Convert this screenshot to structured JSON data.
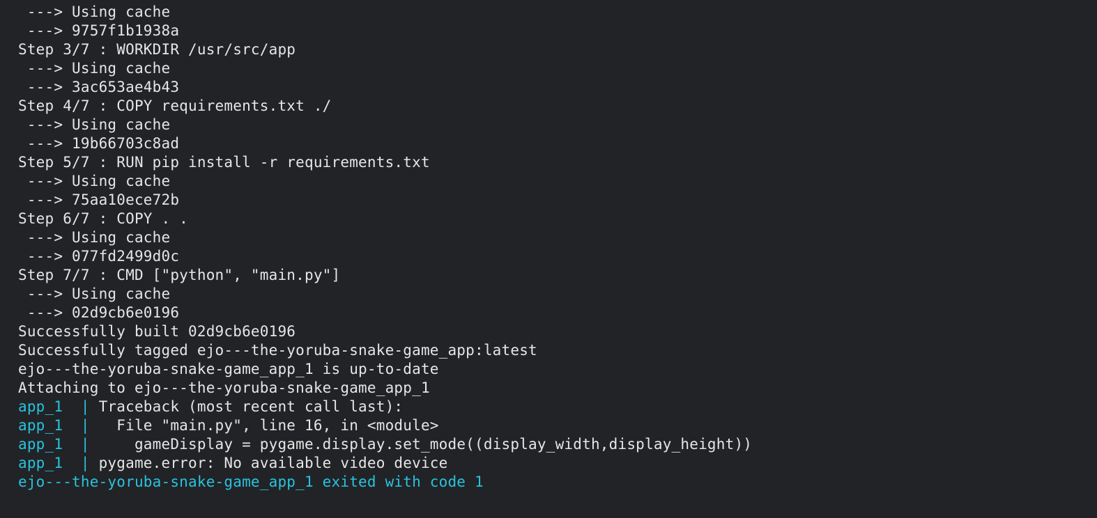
{
  "lines": [
    {
      "segments": [
        {
          "text": " ---> Using cache"
        }
      ]
    },
    {
      "segments": [
        {
          "text": " ---> 9757f1b1938a"
        }
      ]
    },
    {
      "segments": [
        {
          "text": "Step 3/7 : WORKDIR /usr/src/app"
        }
      ]
    },
    {
      "segments": [
        {
          "text": " ---> Using cache"
        }
      ]
    },
    {
      "segments": [
        {
          "text": " ---> 3ac653ae4b43"
        }
      ]
    },
    {
      "segments": [
        {
          "text": "Step 4/7 : COPY requirements.txt ./"
        }
      ]
    },
    {
      "segments": [
        {
          "text": " ---> Using cache"
        }
      ]
    },
    {
      "segments": [
        {
          "text": " ---> 19b66703c8ad"
        }
      ]
    },
    {
      "segments": [
        {
          "text": "Step 5/7 : RUN pip install -r requirements.txt"
        }
      ]
    },
    {
      "segments": [
        {
          "text": " ---> Using cache"
        }
      ]
    },
    {
      "segments": [
        {
          "text": " ---> 75aa10ece72b"
        }
      ]
    },
    {
      "segments": [
        {
          "text": "Step 6/7 : COPY . ."
        }
      ]
    },
    {
      "segments": [
        {
          "text": " ---> Using cache"
        }
      ]
    },
    {
      "segments": [
        {
          "text": " ---> 077fd2499d0c"
        }
      ]
    },
    {
      "segments": [
        {
          "text": "Step 7/7 : CMD [\"python\", \"main.py\"]"
        }
      ]
    },
    {
      "segments": [
        {
          "text": " ---> Using cache"
        }
      ]
    },
    {
      "segments": [
        {
          "text": " ---> 02d9cb6e0196"
        }
      ]
    },
    {
      "segments": [
        {
          "text": "Successfully built 02d9cb6e0196"
        }
      ]
    },
    {
      "segments": [
        {
          "text": "Successfully tagged ejo---the-yoruba-snake-game_app:latest"
        }
      ]
    },
    {
      "segments": [
        {
          "text": "ejo---the-yoruba-snake-game_app_1 is up-to-date"
        }
      ]
    },
    {
      "segments": [
        {
          "text": "Attaching to ejo---the-yoruba-snake-game_app_1"
        }
      ]
    },
    {
      "segments": [
        {
          "text": "app_1  |",
          "class": "cyan"
        },
        {
          "text": " Traceback (most recent call last):"
        }
      ]
    },
    {
      "segments": [
        {
          "text": "app_1  |",
          "class": "cyan"
        },
        {
          "text": "   File \"main.py\", line 16, in <module>"
        }
      ]
    },
    {
      "segments": [
        {
          "text": "app_1  |",
          "class": "cyan"
        },
        {
          "text": "     gameDisplay = pygame.display.set_mode((display_width,display_height))"
        }
      ]
    },
    {
      "segments": [
        {
          "text": "app_1  |",
          "class": "cyan"
        },
        {
          "text": " pygame.error: No available video device"
        }
      ]
    },
    {
      "segments": [
        {
          "text": "ejo---the-yoruba-snake-game_app_1 exited with code 1",
          "class": "cyan"
        }
      ]
    }
  ]
}
